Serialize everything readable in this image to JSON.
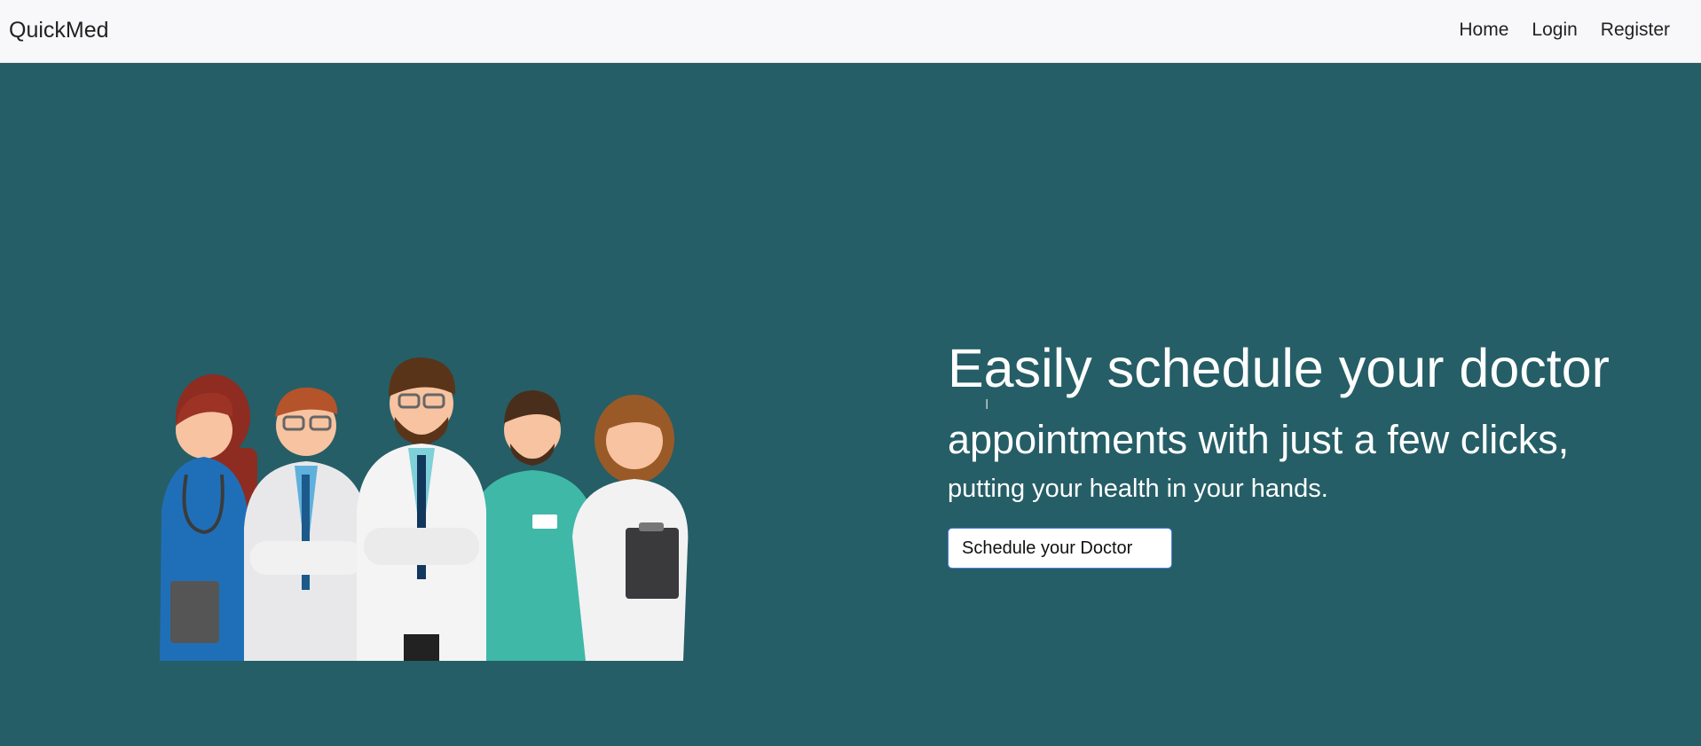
{
  "navbar": {
    "brand": "QuickMed",
    "links": [
      {
        "label": "Home"
      },
      {
        "label": "Login"
      },
      {
        "label": "Register"
      }
    ]
  },
  "hero": {
    "headline": "Easily schedule your doctor",
    "subline": "appointments with just a few clicks,",
    "tagline": "putting your health in your hands.",
    "cta_label": "Schedule your Doctor",
    "illustration_icon": "doctors-group-illustration",
    "colors": {
      "background": "#255e66",
      "navbar": "#f8f8fa",
      "text": "#ffffff"
    }
  }
}
